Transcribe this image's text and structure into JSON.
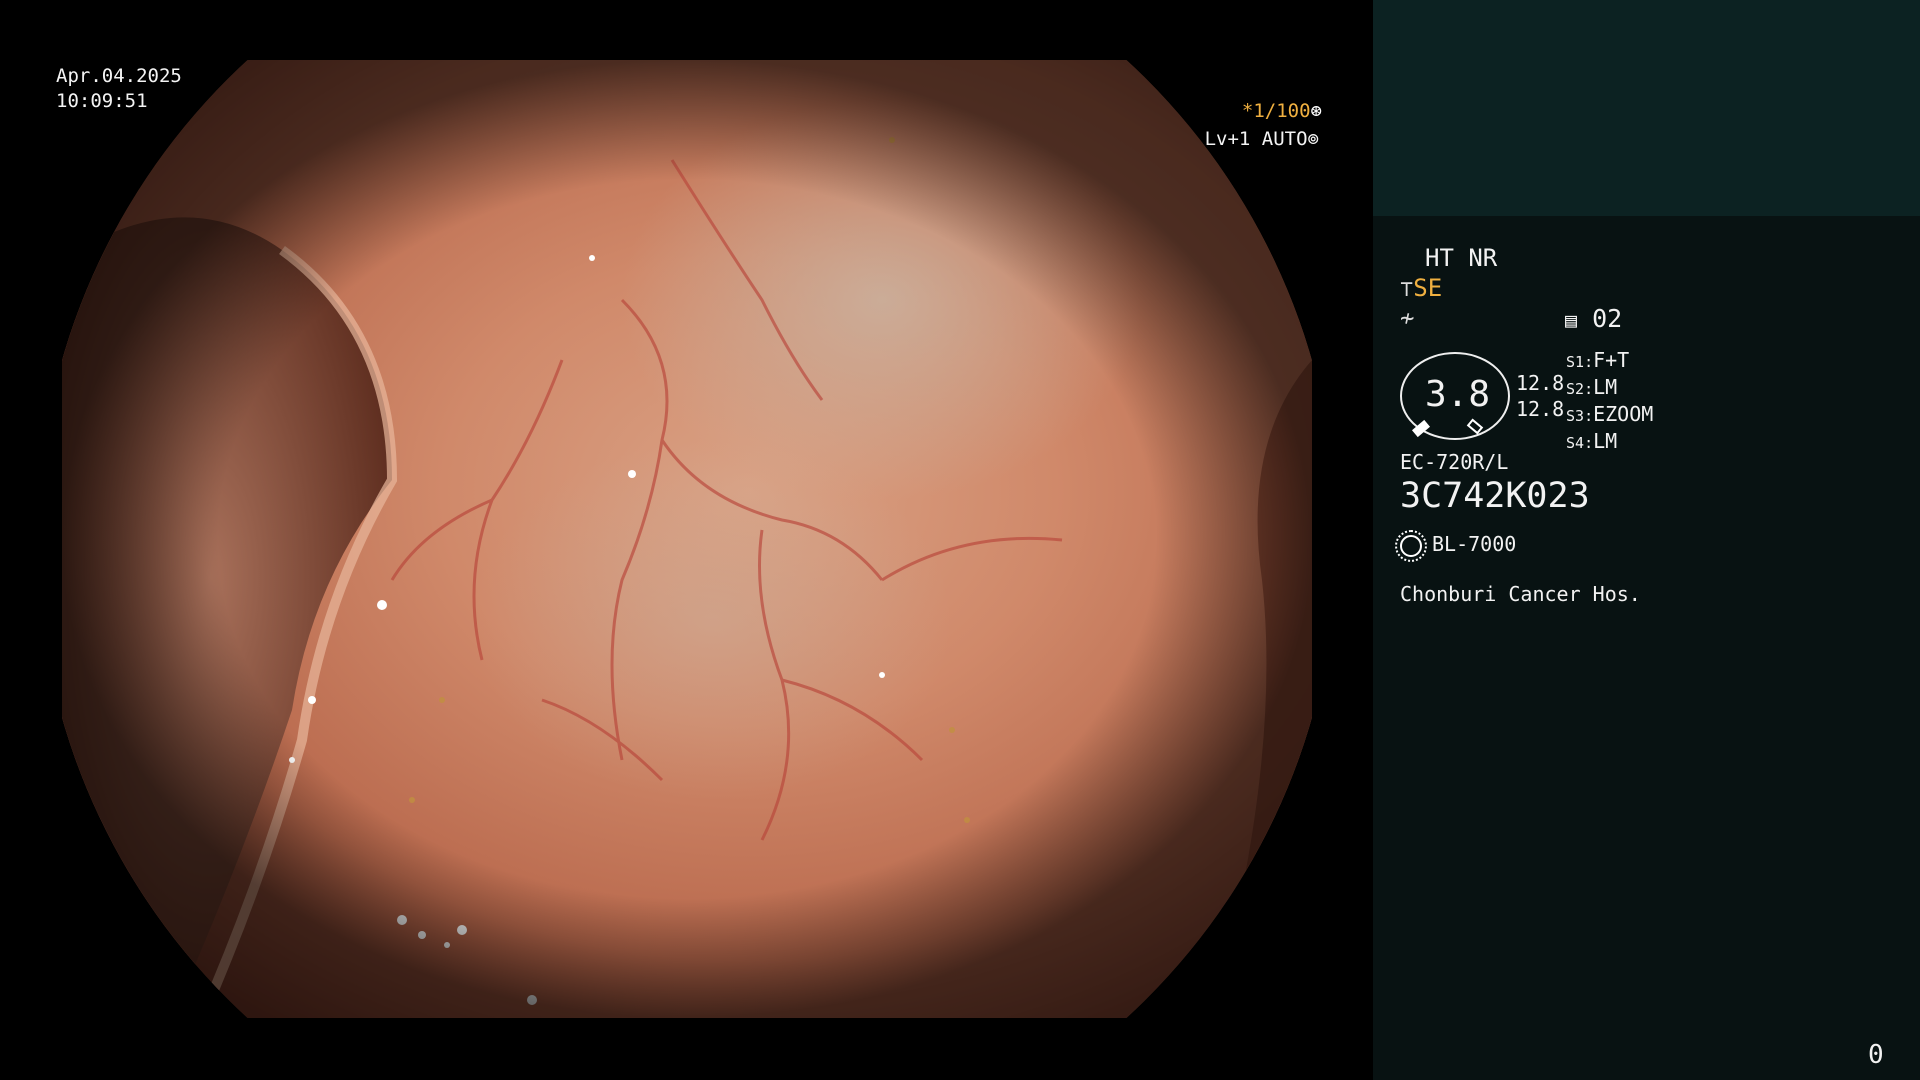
{
  "overlay": {
    "date": "Apr.04.2025",
    "time": "10:09:51",
    "shutter": "*1/100",
    "shutter_icon": "shutter-icon",
    "level": "Lv+1 AUTO",
    "level_icon": "iris-icon"
  },
  "panel": {
    "ht_nr": "HT NR",
    "se": "SE",
    "se_icon": "structure-enhance-icon",
    "filter_icon": "color-filter-icon",
    "memory_icon": "memory-card-icon",
    "memory": "02",
    "oval_value": "3.8",
    "oval_top": "12.8",
    "oval_bottom": "12.8",
    "switches": [
      {
        "label": "S1",
        "value": "F+T"
      },
      {
        "label": "S2",
        "value": "LM"
      },
      {
        "label": "S3",
        "value": "EZOOM"
      },
      {
        "label": "S4",
        "value": "LM"
      }
    ],
    "scope_model": "EC-720R/L",
    "serial": "3C742K023",
    "light_icon": "light-source-icon",
    "light_source": "BL-7000",
    "hospital": "Chonburi Cancer Hos.",
    "counter": "0"
  },
  "colors": {
    "accent_orange": "#f0b040",
    "panel_bg": "#081212",
    "panel_top_bg": "#0c2222"
  }
}
